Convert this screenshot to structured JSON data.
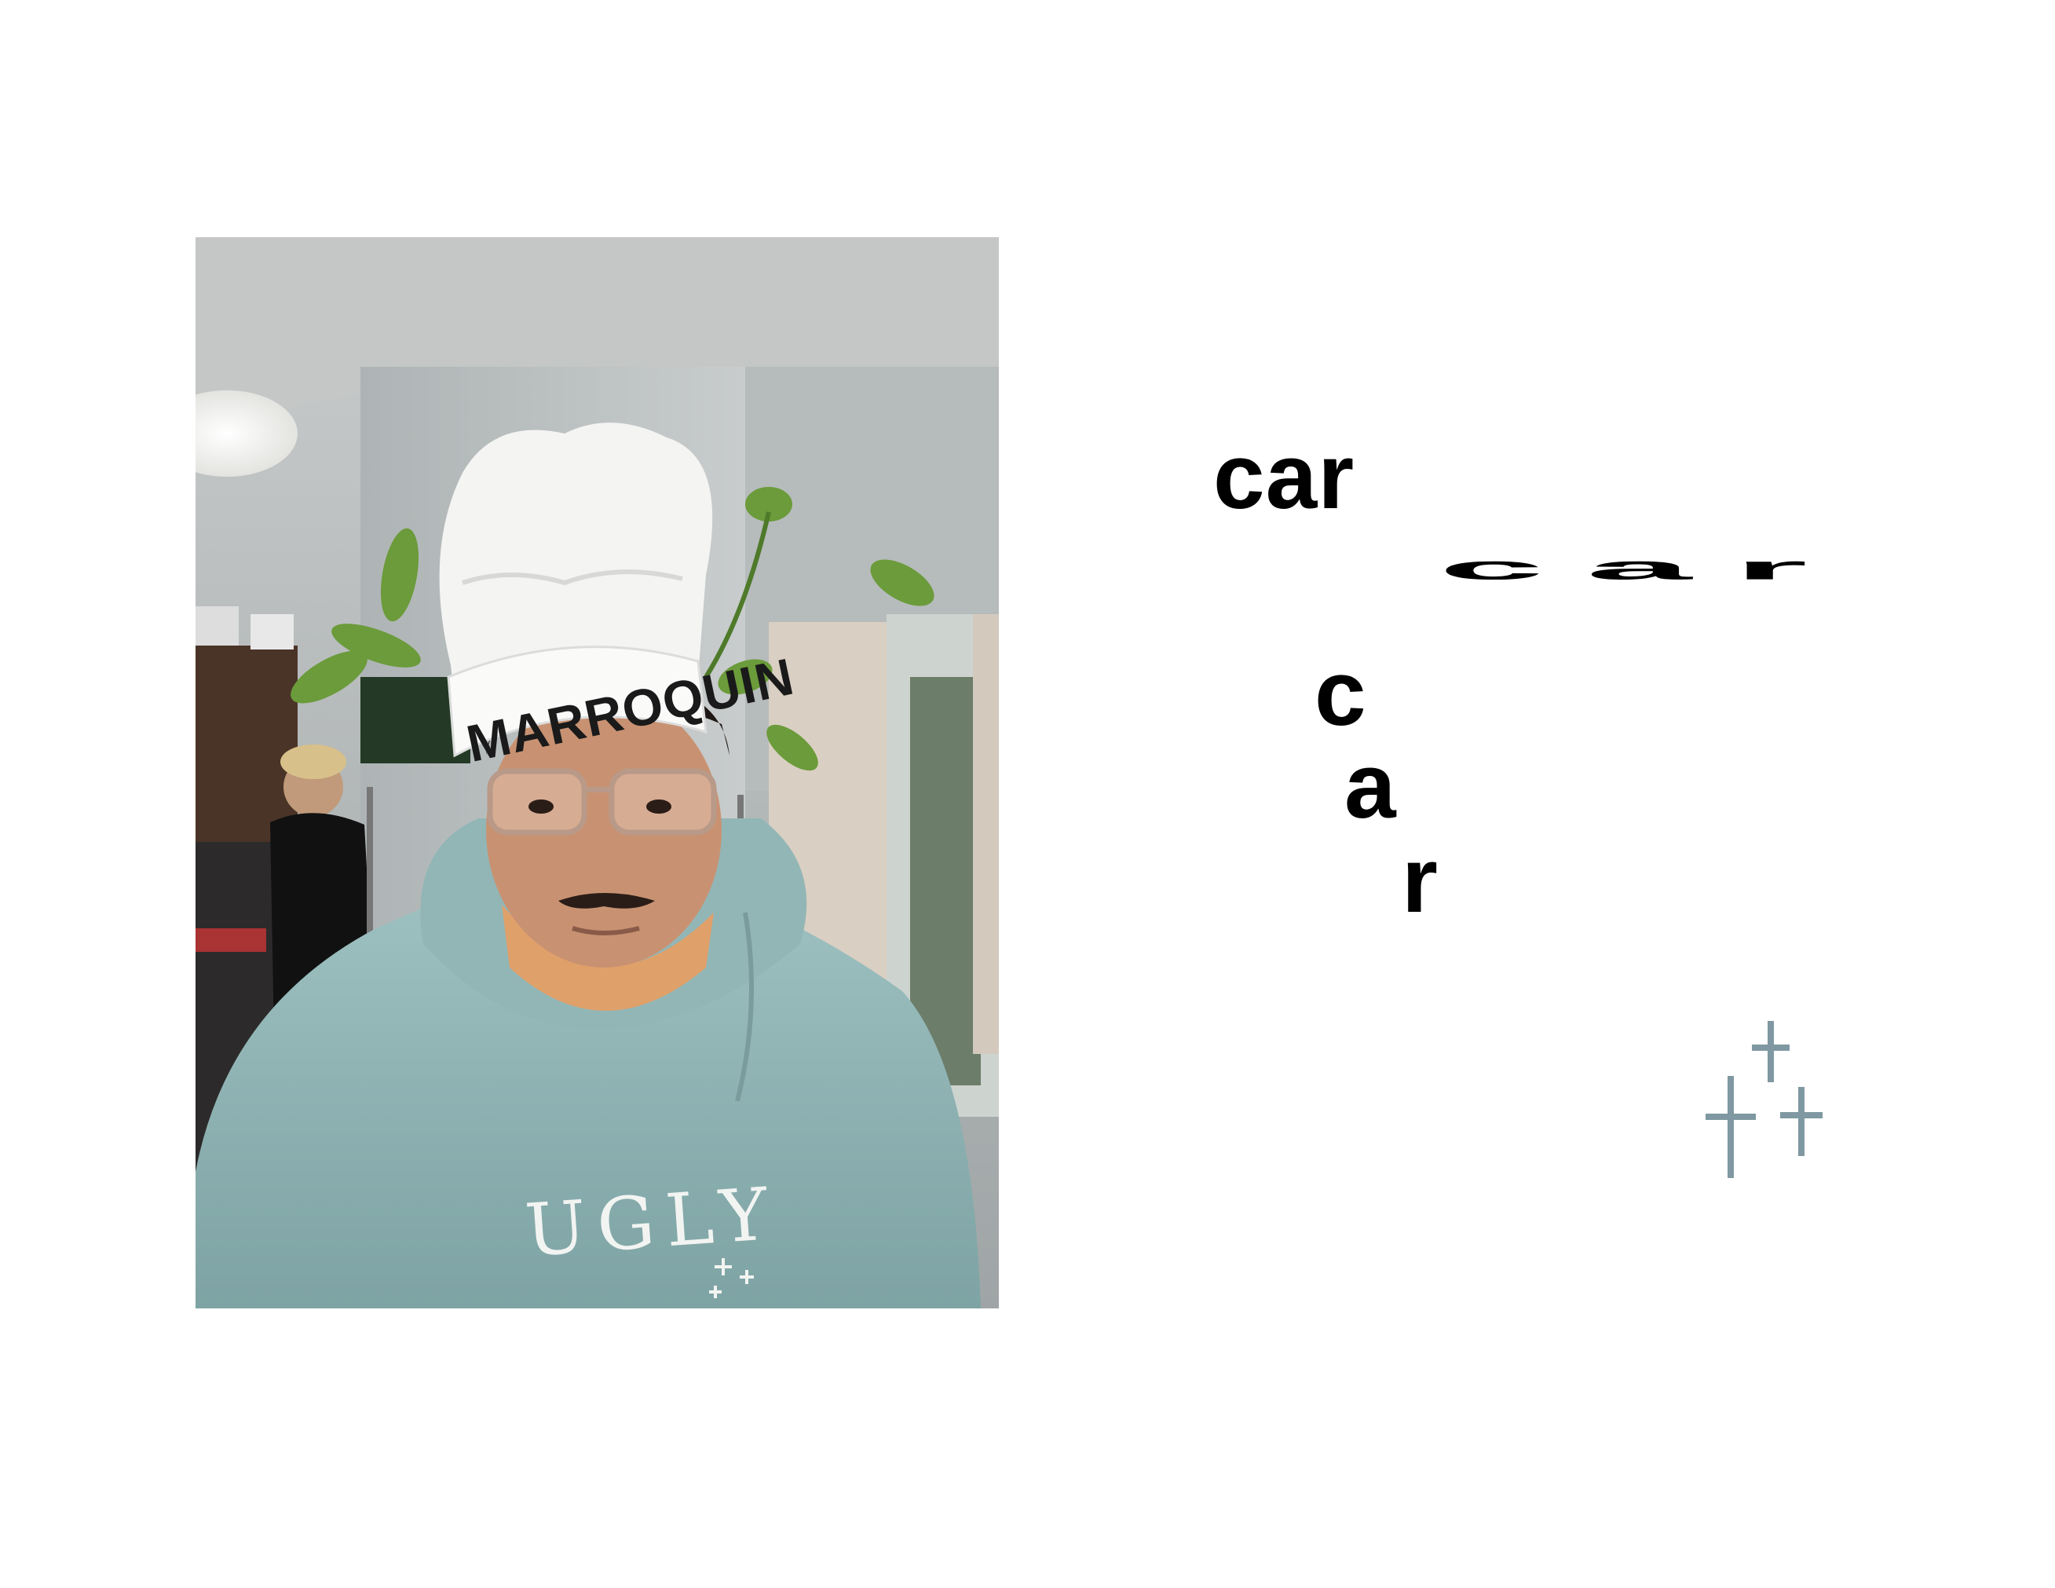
{
  "photo": {
    "hat_text": "MARROQUIN",
    "sweatshirt_text": "UGLY"
  },
  "words": {
    "car_1": "car",
    "car_2": "car",
    "car_3_letters": [
      "c",
      "a",
      "r"
    ]
  },
  "decor": {
    "cross_icon": "cross-icon",
    "cross_color": "#7f98a1"
  },
  "colors": {
    "background": "#ffffff",
    "text": "#000000",
    "hoodie": "#8fb2b2"
  }
}
